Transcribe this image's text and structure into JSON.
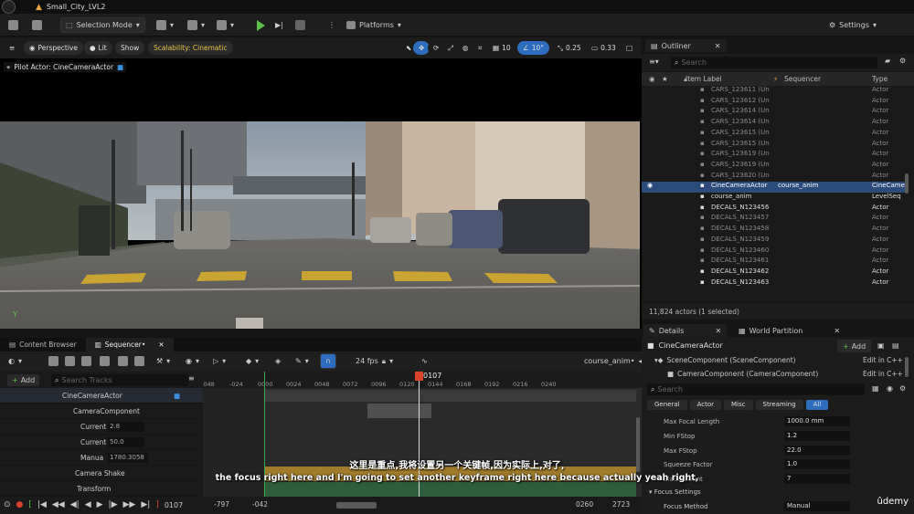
{
  "titlebar": {
    "project_name": "Small_City_LVL2"
  },
  "toolbar": {
    "selection_mode": "Selection Mode",
    "platforms": "Platforms",
    "settings": "Settings"
  },
  "viewport": {
    "perspective": "Perspective",
    "lit": "Lit",
    "show": "Show",
    "scalability": "Scalability: Cinematic",
    "grid_value": "10",
    "angle_value": "10°",
    "scale_value": "0.25",
    "camera_speed": "0.33",
    "pilot_label": "Pilot Actor: CineCameraActor",
    "axis_label": "Y"
  },
  "bottom_tabs": {
    "content_browser": "Content Browser",
    "sequencer": "Sequencer•"
  },
  "sequencer": {
    "add_label": "Add",
    "search_placeholder": "Search Tracks",
    "fps": "24 fps",
    "sequence_name": "course_anim•",
    "current_frame": "0107",
    "ruler_ticks": [
      "-048",
      "-024",
      "0000",
      "0024",
      "0048",
      "0072",
      "0096",
      "0120",
      "0144",
      "0168",
      "0192",
      "0216",
      "0240"
    ],
    "tracks": [
      {
        "label": "CineCameraActor",
        "value": ""
      },
      {
        "label": "CameraComponent",
        "value": ""
      },
      {
        "label": "Current",
        "value": "2.8"
      },
      {
        "label": "Current",
        "value": "50.0"
      },
      {
        "label": "Manua",
        "value": "1780.3058"
      },
      {
        "label": "Camera Shake",
        "value": ""
      },
      {
        "label": "Transform",
        "value": ""
      }
    ],
    "bottom_frame": "0107",
    "range_start_a": "-797",
    "range_start_b": "-042",
    "range_end_a": "0260",
    "range_end_b": "2723"
  },
  "outliner": {
    "title": "Outliner",
    "search_placeholder": "Search",
    "col_item": "Item Label",
    "col_sequencer": "Sequencer",
    "col_type": "Type",
    "rows": [
      {
        "name": "CARS_123611 (Un",
        "seq": "",
        "type": "Actor",
        "state": "dim"
      },
      {
        "name": "CARS_123612 (Un",
        "seq": "",
        "type": "Actor",
        "state": "dim"
      },
      {
        "name": "CARS_123614 (Un",
        "seq": "",
        "type": "Actor",
        "state": "dim"
      },
      {
        "name": "CARS_123614 (Un",
        "seq": "",
        "type": "Actor",
        "state": "dim"
      },
      {
        "name": "CARS_123615 (Un",
        "seq": "",
        "type": "Actor",
        "state": "dim"
      },
      {
        "name": "CARS_123615 (Un",
        "seq": "",
        "type": "Actor",
        "state": "dim"
      },
      {
        "name": "CARS_123619 (Un",
        "seq": "",
        "type": "Actor",
        "state": "dim"
      },
      {
        "name": "CARS_123619 (Un",
        "seq": "",
        "type": "Actor",
        "state": "dim"
      },
      {
        "name": "CARS_123620 (Un",
        "seq": "",
        "type": "Actor",
        "state": "dim"
      },
      {
        "name": "CineCameraActor",
        "seq": "course_anim",
        "type": "CineCame",
        "state": "sel"
      },
      {
        "name": "course_anim",
        "seq": "",
        "type": "LevelSeq",
        "state": "bright"
      },
      {
        "name": "DECALS_N123456",
        "seq": "",
        "type": "Actor",
        "state": "bright"
      },
      {
        "name": "DECALS_N123457",
        "seq": "",
        "type": "Actor",
        "state": "dim"
      },
      {
        "name": "DECALS_N123458",
        "seq": "",
        "type": "Actor",
        "state": "dim"
      },
      {
        "name": "DECALS_N123459",
        "seq": "",
        "type": "Actor",
        "state": "dim"
      },
      {
        "name": "DECALS_N123460",
        "seq": "",
        "type": "Actor",
        "state": "dim"
      },
      {
        "name": "DECALS_N123461",
        "seq": "",
        "type": "Actor",
        "state": "dim"
      },
      {
        "name": "DECALS_N123462",
        "seq": "",
        "type": "Actor",
        "state": "bright"
      },
      {
        "name": "DECALS_N123463",
        "seq": "",
        "type": "Actor",
        "state": "bright"
      }
    ],
    "footer": "11,824 actors (1 selected)"
  },
  "details": {
    "tab_details": "Details",
    "tab_world_partition": "World Partition",
    "actor_name": "CineCameraActor",
    "add_label": "Add",
    "scene_component": "SceneComponent (SceneComponent)",
    "camera_component": "CameraComponent (CameraComponent)",
    "edit_cpp": "Edit in C++",
    "search_placeholder": "Search",
    "filters": [
      "General",
      "Actor",
      "Misc",
      "Streaming",
      "All"
    ],
    "properties": [
      {
        "label": "Max Focal Length",
        "value": "1000.0 mm"
      },
      {
        "label": "Min FStop",
        "value": "1.2"
      },
      {
        "label": "Max FStop",
        "value": "22.0"
      },
      {
        "label": "Squeeze Factor",
        "value": "1.0"
      },
      {
        "label": "Blade Count",
        "value": "7"
      }
    ],
    "focus_settings": "Focus Settings",
    "focus_method_label": "Focus Method",
    "focus_method_value": "Manual"
  },
  "subtitles": {
    "chinese": "这里是重点,我将设置另一个关键帧,因为实际上,对了,",
    "english": "the focus right here and I'm going to set another keyframe right here because actually yeah right,"
  },
  "watermark": "ûdemy",
  "colors": {
    "accent_blue": "#2d4b7a",
    "play_green": "#5fbf4a",
    "scalability_yellow": "#e5c542",
    "playhead_red": "#d9442b"
  }
}
